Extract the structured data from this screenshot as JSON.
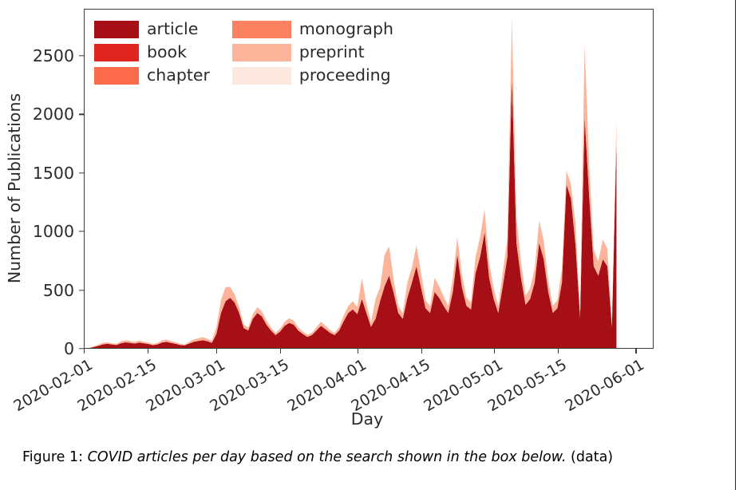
{
  "figure": {
    "caption_prefix": "Figure 1:",
    "caption_emphasis": "COVID articles per day based on the search shown in the box below.",
    "caption_suffix": "(data)"
  },
  "legend": {
    "items": [
      {
        "label": "article",
        "color": "#a50f15"
      },
      {
        "label": "monograph",
        "color": "#fc8161"
      },
      {
        "label": "book",
        "color": "#e02420"
      },
      {
        "label": "preprint",
        "color": "#fcb59b"
      },
      {
        "label": "chapter",
        "color": "#fb6a4a"
      },
      {
        "label": "proceeding",
        "color": "#fde8df"
      }
    ]
  },
  "chart_data": {
    "type": "area",
    "stacked": true,
    "title": "",
    "xlabel": "Day",
    "ylabel": "Number of Publications",
    "ylim": [
      0,
      2900
    ],
    "yticks": [
      0,
      500,
      1000,
      1500,
      2000,
      2500
    ],
    "xticks": [
      "2020-02-01",
      "2020-02-15",
      "2020-03-01",
      "2020-03-15",
      "2020-04-01",
      "2020-04-15",
      "2020-05-01",
      "2020-05-15",
      "2020-06-01"
    ],
    "xlim": [
      "2020-02-01",
      "2020-06-05"
    ],
    "grid": false,
    "legend_position": "upper left",
    "x": [
      "2020-02-01",
      "2020-02-02",
      "2020-02-03",
      "2020-02-04",
      "2020-02-05",
      "2020-02-06",
      "2020-02-07",
      "2020-02-08",
      "2020-02-09",
      "2020-02-10",
      "2020-02-11",
      "2020-02-12",
      "2020-02-13",
      "2020-02-14",
      "2020-02-15",
      "2020-02-16",
      "2020-02-17",
      "2020-02-18",
      "2020-02-19",
      "2020-02-20",
      "2020-02-21",
      "2020-02-22",
      "2020-02-23",
      "2020-02-24",
      "2020-02-25",
      "2020-02-26",
      "2020-02-27",
      "2020-02-28",
      "2020-02-29",
      "2020-03-01",
      "2020-03-02",
      "2020-03-03",
      "2020-03-04",
      "2020-03-05",
      "2020-03-06",
      "2020-03-07",
      "2020-03-08",
      "2020-03-09",
      "2020-03-10",
      "2020-03-11",
      "2020-03-12",
      "2020-03-13",
      "2020-03-14",
      "2020-03-15",
      "2020-03-16",
      "2020-03-17",
      "2020-03-18",
      "2020-03-19",
      "2020-03-20",
      "2020-03-21",
      "2020-03-22",
      "2020-03-23",
      "2020-03-24",
      "2020-03-25",
      "2020-03-26",
      "2020-03-27",
      "2020-03-28",
      "2020-03-29",
      "2020-03-30",
      "2020-03-31",
      "2020-04-01",
      "2020-04-02",
      "2020-04-03",
      "2020-04-04",
      "2020-04-05",
      "2020-04-06",
      "2020-04-07",
      "2020-04-08",
      "2020-04-09",
      "2020-04-10",
      "2020-04-11",
      "2020-04-12",
      "2020-04-13",
      "2020-04-14",
      "2020-04-15",
      "2020-04-16",
      "2020-04-17",
      "2020-04-18",
      "2020-04-19",
      "2020-04-20",
      "2020-04-21",
      "2020-04-22",
      "2020-04-23",
      "2020-04-24",
      "2020-04-25",
      "2020-04-26",
      "2020-04-27",
      "2020-04-28",
      "2020-04-29",
      "2020-04-30",
      "2020-05-01",
      "2020-05-02",
      "2020-05-03",
      "2020-05-04",
      "2020-05-05",
      "2020-05-06",
      "2020-05-07",
      "2020-05-08",
      "2020-05-09",
      "2020-05-10",
      "2020-05-11",
      "2020-05-12",
      "2020-05-13",
      "2020-05-14",
      "2020-05-15",
      "2020-05-16",
      "2020-05-17",
      "2020-05-18",
      "2020-05-19",
      "2020-05-20",
      "2020-05-21",
      "2020-05-22",
      "2020-05-23",
      "2020-05-24",
      "2020-05-25",
      "2020-05-26",
      "2020-05-27",
      "2020-05-28"
    ],
    "series": [
      {
        "name": "article",
        "color": "#a50f15",
        "values": [
          0,
          0,
          8,
          18,
          30,
          36,
          30,
          26,
          40,
          48,
          44,
          38,
          46,
          40,
          34,
          24,
          30,
          46,
          52,
          44,
          36,
          26,
          22,
          38,
          52,
          60,
          66,
          58,
          44,
          120,
          300,
          400,
          430,
          390,
          300,
          170,
          150,
          250,
          300,
          270,
          200,
          150,
          110,
          140,
          190,
          215,
          200,
          150,
          120,
          95,
          110,
          150,
          190,
          160,
          130,
          110,
          150,
          230,
          300,
          330,
          290,
          420,
          300,
          180,
          250,
          400,
          530,
          620,
          470,
          300,
          250,
          430,
          560,
          700,
          520,
          340,
          300,
          480,
          430,
          360,
          300,
          480,
          800,
          520,
          360,
          330,
          640,
          780,
          990,
          600,
          420,
          300,
          530,
          780,
          2320,
          900,
          600,
          370,
          420,
          560,
          900,
          760,
          480,
          300,
          340,
          560,
          1400,
          1280,
          880,
          260,
          1980,
          1300,
          700,
          620,
          760,
          700,
          180,
          1760
        ]
      },
      {
        "name": "book",
        "color": "#e02420",
        "values": [
          0,
          0,
          0,
          0,
          0,
          0,
          0,
          0,
          0,
          0,
          0,
          0,
          0,
          0,
          0,
          0,
          0,
          0,
          0,
          0,
          0,
          0,
          0,
          0,
          0,
          0,
          0,
          0,
          0,
          0,
          0,
          0,
          0,
          0,
          0,
          0,
          0,
          0,
          0,
          0,
          0,
          0,
          0,
          0,
          0,
          0,
          0,
          0,
          0,
          0,
          0,
          0,
          0,
          0,
          0,
          0,
          0,
          0,
          0,
          0,
          0,
          0,
          0,
          0,
          0,
          0,
          0,
          0,
          0,
          0,
          0,
          0,
          0,
          0,
          0,
          0,
          0,
          0,
          0,
          0,
          0,
          0,
          0,
          0,
          0,
          0,
          0,
          0,
          0,
          0,
          0,
          0,
          0,
          0,
          0,
          0,
          0,
          0,
          0,
          0,
          0,
          0,
          0,
          0,
          0,
          0,
          0,
          0,
          0,
          0,
          0,
          0,
          0,
          0,
          0,
          0,
          0,
          0,
          0
        ]
      },
      {
        "name": "chapter",
        "color": "#fb6a4a",
        "values": [
          0,
          0,
          0,
          0,
          0,
          0,
          0,
          0,
          0,
          0,
          0,
          0,
          0,
          0,
          0,
          0,
          0,
          0,
          0,
          0,
          0,
          0,
          0,
          0,
          0,
          0,
          0,
          0,
          0,
          0,
          0,
          0,
          0,
          0,
          0,
          0,
          0,
          0,
          0,
          0,
          0,
          0,
          0,
          0,
          0,
          0,
          0,
          0,
          0,
          0,
          0,
          0,
          0,
          0,
          0,
          0,
          0,
          0,
          0,
          0,
          0,
          0,
          0,
          0,
          0,
          0,
          0,
          0,
          0,
          0,
          0,
          0,
          0,
          0,
          0,
          0,
          0,
          0,
          0,
          0,
          0,
          0,
          0,
          0,
          0,
          0,
          0,
          0,
          0,
          0,
          0,
          0,
          0,
          0,
          0,
          0,
          0,
          0,
          0,
          0,
          0,
          0,
          0,
          0,
          0,
          0,
          0,
          0,
          0,
          0,
          0,
          0,
          0,
          0,
          0,
          0,
          0,
          0,
          0
        ]
      },
      {
        "name": "monograph",
        "color": "#fc8161",
        "values": [
          0,
          0,
          0,
          0,
          0,
          0,
          0,
          0,
          0,
          0,
          0,
          0,
          0,
          0,
          0,
          0,
          0,
          0,
          0,
          0,
          0,
          0,
          0,
          0,
          0,
          0,
          0,
          0,
          0,
          0,
          0,
          0,
          0,
          0,
          0,
          0,
          0,
          0,
          0,
          0,
          0,
          0,
          0,
          0,
          0,
          0,
          0,
          0,
          0,
          0,
          0,
          0,
          0,
          0,
          0,
          0,
          0,
          0,
          0,
          0,
          0,
          0,
          0,
          0,
          0,
          0,
          0,
          0,
          0,
          0,
          0,
          0,
          0,
          0,
          0,
          0,
          0,
          0,
          0,
          0,
          0,
          0,
          0,
          0,
          0,
          0,
          0,
          0,
          0,
          0,
          0,
          0,
          0,
          0,
          0,
          0,
          0,
          0,
          0,
          0,
          0,
          0,
          0,
          0,
          0,
          0,
          0,
          0,
          0,
          0,
          0,
          0,
          0,
          0,
          0,
          0,
          0,
          0,
          0
        ]
      },
      {
        "name": "preprint",
        "color": "#fcb59b",
        "values": [
          0,
          0,
          6,
          10,
          14,
          12,
          10,
          10,
          16,
          18,
          16,
          14,
          18,
          14,
          12,
          10,
          12,
          18,
          20,
          16,
          14,
          10,
          8,
          14,
          20,
          24,
          26,
          22,
          18,
          60,
          110,
          120,
          95,
          70,
          50,
          30,
          26,
          40,
          50,
          45,
          35,
          26,
          20,
          26,
          34,
          40,
          34,
          26,
          22,
          18,
          20,
          28,
          36,
          30,
          24,
          20,
          30,
          50,
          60,
          70,
          60,
          180,
          80,
          40,
          170,
          120,
          270,
          250,
          110,
          60,
          50,
          130,
          130,
          180,
          130,
          70,
          60,
          120,
          100,
          80,
          60,
          120,
          150,
          110,
          70,
          60,
          140,
          170,
          200,
          130,
          90,
          60,
          120,
          160,
          510,
          220,
          140,
          80,
          90,
          120,
          190,
          160,
          100,
          60,
          70,
          120,
          120,
          120,
          180,
          50,
          620,
          260,
          140,
          120,
          170,
          150,
          40,
          200
        ]
      },
      {
        "name": "proceeding",
        "color": "#fde8df",
        "values": [
          0,
          0,
          0,
          0,
          0,
          0,
          0,
          0,
          0,
          0,
          0,
          0,
          0,
          0,
          0,
          0,
          0,
          0,
          0,
          0,
          0,
          0,
          0,
          0,
          0,
          0,
          0,
          0,
          0,
          0,
          0,
          0,
          0,
          0,
          0,
          0,
          0,
          0,
          0,
          0,
          0,
          0,
          0,
          0,
          0,
          0,
          0,
          0,
          0,
          0,
          0,
          0,
          0,
          0,
          0,
          0,
          0,
          0,
          0,
          0,
          0,
          0,
          0,
          0,
          0,
          0,
          0,
          0,
          0,
          0,
          0,
          0,
          0,
          0,
          0,
          0,
          0,
          0,
          0,
          0,
          0,
          0,
          0,
          0,
          0,
          0,
          0,
          0,
          0,
          0,
          0,
          0,
          0,
          0,
          0,
          0,
          0,
          0,
          0,
          0,
          0,
          0,
          0,
          0,
          0,
          0,
          0,
          0,
          0,
          0,
          0,
          0,
          0,
          0,
          0,
          0,
          0,
          0,
          0
        ]
      }
    ]
  }
}
